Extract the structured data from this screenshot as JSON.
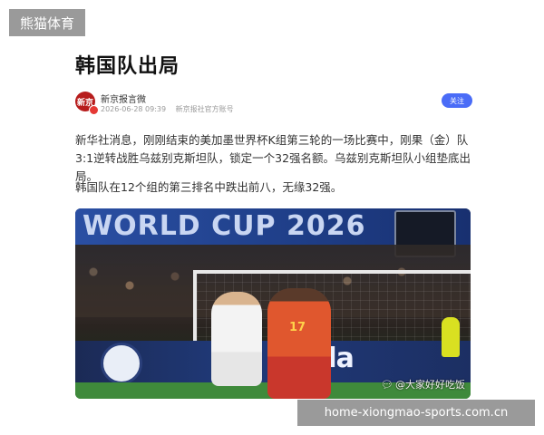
{
  "top_tag": "熊猫体育",
  "article": {
    "title": "韩国队出局",
    "author": {
      "avatar_text": "新京",
      "name": "新京报言微",
      "timestamp": "2026-06-28 09:39",
      "account": "新京报社官方账号",
      "follow_label": "关注"
    },
    "paragraphs": [
      "新华社消息，刚刚结束的美加墨世界杯K组第三轮的一场比赛中，刚果（金）队3:1逆转战胜乌兹别克斯坦队，锁定一个32强名额。乌兹别克斯坦队小组垫底出局。",
      "韩国队在12个组的第三排名中跌出前八，无缘32强。"
    ],
    "photo": {
      "banner_text": "WORLD CUP 2026",
      "adboard_text": "torola",
      "player_number": "17",
      "credit_icon": "chat-bubble-icon",
      "credit": "@大家好好吃饭"
    }
  },
  "footer_tag": "home-xiongmao-sports.com.cn"
}
